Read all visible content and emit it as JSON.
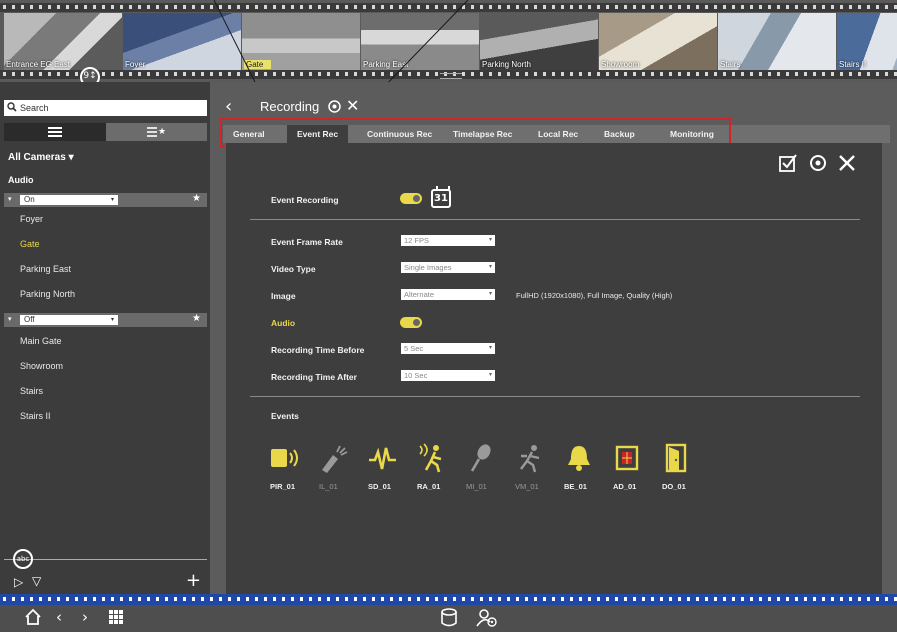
{
  "filmstrip": {
    "cameras": [
      {
        "label": "Entrance EG East",
        "selected": false
      },
      {
        "label": "Foyer",
        "selected": false
      },
      {
        "label": "Gate",
        "selected": true
      },
      {
        "label": "Parking East",
        "selected": false
      },
      {
        "label": "Parking North",
        "selected": false
      },
      {
        "label": "Showroom",
        "selected": false
      },
      {
        "label": "Stairs",
        "selected": false
      },
      {
        "label": "Stairs II",
        "selected": false
      }
    ],
    "sort_button": "9↕"
  },
  "sidebar": {
    "search_placeholder": "Search",
    "all_cameras_label": "All Cameras ▾",
    "audio_header": "Audio",
    "group_on": {
      "value": "On"
    },
    "group_on_items": [
      "Foyer",
      "Gate",
      "Parking East",
      "Parking North"
    ],
    "group_off": {
      "value": "Off"
    },
    "group_off_items": [
      "Main Gate",
      "Showroom",
      "Stairs",
      "Stairs II"
    ],
    "abc_button": "abc"
  },
  "main": {
    "title": "Recording",
    "tabs": [
      "General",
      "Event Rec",
      "Continuous Rec",
      "Timelapse Rec",
      "Local Rec",
      "Backup",
      "Monitoring"
    ],
    "active_tab": "Event Rec",
    "event_recording_label": "Event Recording",
    "calendar_day": "31",
    "fields": {
      "event_frame_rate": {
        "label": "Event Frame Rate",
        "value": "12 FPS"
      },
      "video_type": {
        "label": "Video Type",
        "value": "Single Images"
      },
      "image": {
        "label": "Image",
        "value": "Alternate",
        "description": "FullHD (1920x1080), Full Image, Quality (High)"
      },
      "audio": {
        "label": "Audio"
      },
      "rec_time_before": {
        "label": "Recording Time Before",
        "value": "5 Sec"
      },
      "rec_time_after": {
        "label": "Recording Time After",
        "value": "10 Sec"
      }
    },
    "events_label": "Events",
    "events": [
      {
        "name": "PIR_01",
        "active": true,
        "icon": "pir-sensor-icon"
      },
      {
        "name": "IL_01",
        "active": false,
        "icon": "illumination-icon"
      },
      {
        "name": "SD_01",
        "active": true,
        "icon": "sound-detection-icon"
      },
      {
        "name": "RA_01",
        "active": true,
        "icon": "radar-motion-icon"
      },
      {
        "name": "MI_01",
        "active": false,
        "icon": "microphone-icon"
      },
      {
        "name": "VM_01",
        "active": false,
        "icon": "video-motion-icon"
      },
      {
        "name": "BE_01",
        "active": true,
        "icon": "bell-icon"
      },
      {
        "name": "AD_01",
        "active": true,
        "icon": "audio-detection-icon"
      },
      {
        "name": "DO_01",
        "active": true,
        "icon": "door-icon"
      }
    ]
  },
  "colors": {
    "accent_yellow": "#e8d84a",
    "highlight_red": "#d2232a",
    "strip_blue": "#1f48a8"
  }
}
